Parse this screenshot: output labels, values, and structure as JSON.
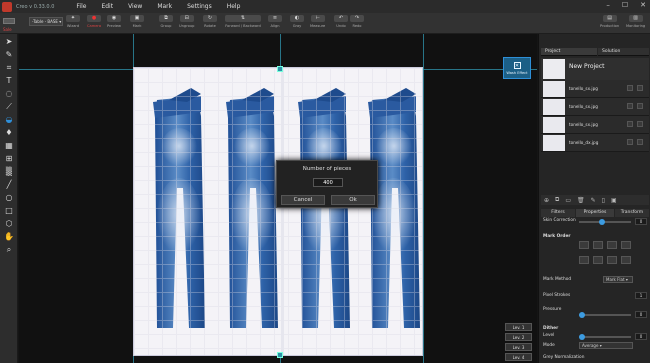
{
  "app": {
    "name": "Creo v 0.33.0.0"
  },
  "menu": [
    "File",
    "Edit",
    "View",
    "Mark",
    "Settings",
    "Help"
  ],
  "toolbar": {
    "swatch_label": "Sale",
    "table_select": "-Table - BASE",
    "buttons": [
      "Wizard",
      "Camera",
      "Preview",
      "Mark",
      "Group",
      "Ungroup",
      "Rotate",
      "Forward / Backward",
      "Align",
      "Gray",
      "Measure",
      "Undo",
      "Redo",
      "Production",
      "Monitoring"
    ]
  },
  "canvas": {
    "wash_effect_label": "Wash Effect",
    "levels": [
      "Lev. 1",
      "Lev. 2",
      "Lev. 3",
      "Lev. 4"
    ]
  },
  "dialog": {
    "title": "Number of pieces",
    "value": "400",
    "cancel_label": "Cancel",
    "ok_label": "Ok"
  },
  "right_panel": {
    "tabs": [
      "Project",
      "Solution"
    ],
    "project_title": "New Project",
    "files": [
      "tonello_sx.jpg",
      "tonello_sx.jpg",
      "tonello_sx.jpg",
      "tonello_dx.jpg"
    ],
    "subtabs": [
      "Filters",
      "Properties",
      "Transform"
    ],
    "skin_correction_label": "Skin Correction",
    "skin_correction_value": "0",
    "mark_order_label": "Mark Order",
    "mark_method_label": "Mark Method",
    "mark_method_value": "Mark Flat",
    "pixel_strokes_label": "Pixel Strokes",
    "pixel_strokes_value": "1",
    "pressure_label": "Pressure",
    "pressure_value": "0",
    "dither_label": "Dither",
    "level_label": "Level",
    "level_value": "0",
    "mode_label": "Mode",
    "mode_value": "Average",
    "grey_normalization_label": "Grey Normalization"
  }
}
